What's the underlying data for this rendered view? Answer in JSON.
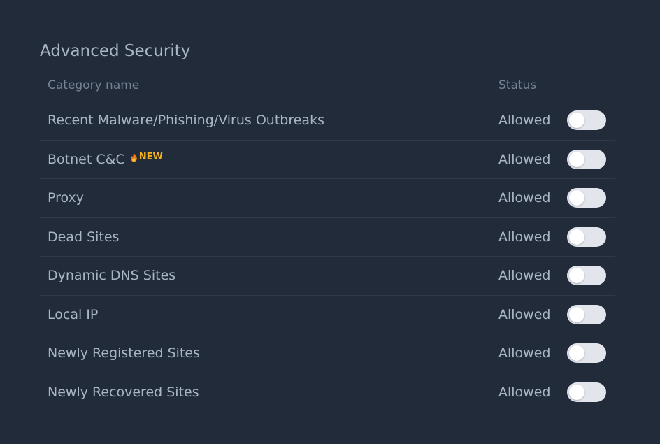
{
  "section": {
    "title": "Advanced Security"
  },
  "table": {
    "headers": {
      "name": "Category name",
      "status": "Status"
    },
    "rows": [
      {
        "name": "Recent Malware/Phishing/Virus Outbreaks",
        "status": "Allowed",
        "enabled": false
      },
      {
        "name": "Botnet C&C",
        "badge": "NEW",
        "status": "Allowed",
        "enabled": false
      },
      {
        "name": "Proxy",
        "status": "Allowed",
        "enabled": false
      },
      {
        "name": "Dead Sites",
        "status": "Allowed",
        "enabled": false
      },
      {
        "name": "Dynamic DNS Sites",
        "status": "Allowed",
        "enabled": false
      },
      {
        "name": "Local IP",
        "status": "Allowed",
        "enabled": false
      },
      {
        "name": "Newly Registered Sites",
        "status": "Allowed",
        "enabled": false
      },
      {
        "name": "Newly Recovered Sites",
        "status": "Allowed",
        "enabled": false
      }
    ]
  },
  "colors": {
    "background": "#222b3a",
    "text": "#a9b6c6",
    "header_text": "#768396",
    "badge": "#f2b01e",
    "toggle_off": "#e3e5ec"
  }
}
